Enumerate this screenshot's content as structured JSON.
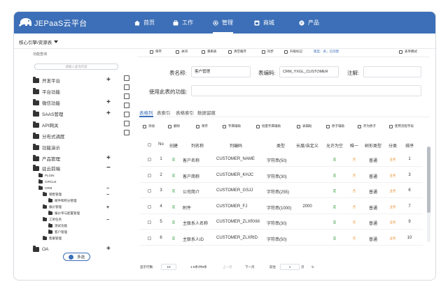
{
  "header": {
    "brand": "JEPaaS云平台",
    "nav": [
      {
        "label": "首页",
        "icon": "home-icon"
      },
      {
        "label": "工作",
        "icon": "briefcase-icon"
      },
      {
        "label": "管理",
        "icon": "gear-icon",
        "active": true
      },
      {
        "label": "商城",
        "icon": "store-icon"
      },
      {
        "label": "产品",
        "icon": "product-icon"
      }
    ],
    "accent_color": "#3c6fb7"
  },
  "breadcrumb": "核心引擎/资源表",
  "sidebar": {
    "search_label": "功能查询",
    "search_placeholder": "请输入查询内容",
    "tree": [
      {
        "label": "开发平台",
        "control": "+"
      },
      {
        "label": "平台功能",
        "control": ""
      },
      {
        "label": "微信功能",
        "control": "+"
      },
      {
        "label": "SAAS管理",
        "control": "+"
      },
      {
        "label": "API网关",
        "control": ""
      },
      {
        "label": "分布式调度",
        "control": ""
      },
      {
        "label": "功能演示",
        "control": ""
      },
      {
        "label": "产品管理",
        "control": "+"
      },
      {
        "label": "驻云前端",
        "control": "−"
      }
    ],
    "subtree": [
      {
        "label": "PLGIN",
        "control": ""
      },
      {
        "label": "CIRCLE",
        "control": ""
      },
      {
        "label": "CRM",
        "control": "−"
      },
      {
        "label": "销售管理",
        "control": "−"
      },
      {
        "label": "邮件和积分管理",
        "control": ""
      },
      {
        "label": "报价管理",
        "control": "+"
      },
      {
        "label": "报价单与配置管理",
        "control": ""
      },
      {
        "label": "工单任务",
        "control": "−"
      },
      {
        "label": "测试功能",
        "control": ""
      },
      {
        "label": "客户管理",
        "control": ""
      },
      {
        "label": "客服管理",
        "control": ""
      }
    ],
    "last_item": {
      "label": "OA",
      "control": "+"
    },
    "multi_select_label": "多选"
  },
  "toolbar": {
    "buttons": [
      "保存",
      "关闭",
      "重刷表",
      "清空缓存",
      "同步",
      "升级标记"
    ],
    "status_text": "版型：表；已创建",
    "right_button": "表单模式"
  },
  "form": {
    "table_name_label": "表名称:",
    "table_name_value": "客户管理",
    "table_code_label": "表编码:",
    "table_code_value": "CRM_YXGL_CUSTOMER",
    "notes_label": "注解:",
    "notes_value": "",
    "used_by_label": "使用此表的功能:",
    "used_by_value": ""
  },
  "tabs": [
    "表格列",
    "表索引",
    "表格索引",
    "数据留痕"
  ],
  "subtoolbar": [
    "添加",
    "删除",
    "保存",
    "字典辅助",
    "批量字典辅助",
    "表辅助",
    "原子辅助",
    "存为原子",
    "使用流程字段"
  ],
  "grid": {
    "headers": [
      "No",
      "创建",
      "列名称",
      "列编码",
      "类型",
      "长度/自定义",
      "允许为空",
      "唯一",
      "树形类型",
      "分类",
      "排序"
    ],
    "rows": [
      {
        "no": "1",
        "created": "是",
        "name": "客户名称",
        "code": "CUSTOMER_NAME",
        "type": "字符串(50)",
        "length": "",
        "nullable": "是",
        "unique": "否",
        "tree_type": "普通",
        "category": "业务",
        "order": "1"
      },
      {
        "no": "2",
        "created": "是",
        "name": "客户简称",
        "code": "CUSTOMER_KHJC",
        "type": "字符串(30)",
        "length": "",
        "nullable": "是",
        "unique": "否",
        "tree_type": "普通",
        "category": "业务",
        "order": "3"
      },
      {
        "no": "3",
        "created": "是",
        "name": "公司简介",
        "code": "CUSTOMER_GSJJ",
        "type": "字符串(255)",
        "length": "",
        "nullable": "是",
        "unique": "否",
        "tree_type": "普通",
        "category": "业务",
        "order": "6"
      },
      {
        "no": "4",
        "created": "是",
        "name": "附件",
        "code": "CUSTOMER_FJ",
        "type": "字符串(1000)",
        "length": "2000",
        "nullable": "是",
        "unique": "否",
        "tree_type": "普通",
        "category": "业务",
        "order": "7"
      },
      {
        "no": "5",
        "created": "是",
        "name": "主联系人名称",
        "code": "CUSTOMER_ZLXRXM",
        "type": "字符串(30)",
        "length": "",
        "nullable": "是",
        "unique": "否",
        "tree_type": "普通",
        "category": "业务",
        "order": "9"
      },
      {
        "no": "6",
        "created": "是",
        "name": "主联系人ID",
        "code": "CUSTOMER_ZLXRID",
        "type": "字符串(50)",
        "length": "",
        "nullable": "是",
        "unique": "否",
        "tree_type": "普通",
        "category": "业务",
        "order": "10"
      }
    ]
  },
  "pager": {
    "page_size_label": "显示行数:",
    "page_size": "10",
    "range_text": "1-8条/共8条",
    "prev": "上一页",
    "next": "下一页",
    "page_label": "前往",
    "page_value": "1",
    "page_suffix": "页"
  }
}
